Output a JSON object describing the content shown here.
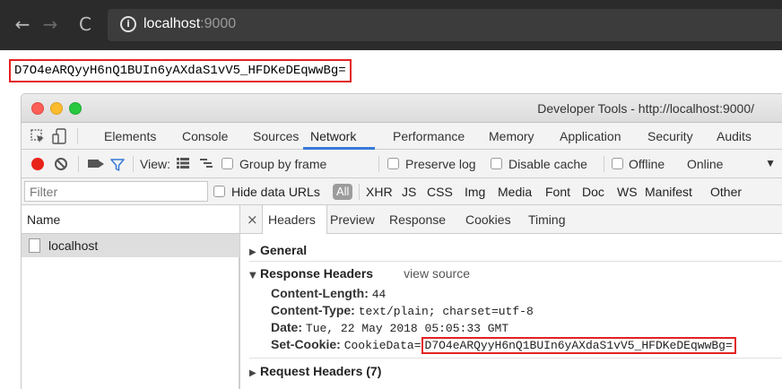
{
  "browser": {
    "back_glyph": "←",
    "forward_glyph": "→",
    "reload_glyph": "C",
    "info_glyph": "i",
    "url_host": "localhost",
    "url_port": ":9000"
  },
  "page": {
    "output_text": "D7O4eARQyyH6nQ1BUIn6yAXdaS1vV5_HFDKeDEqwwBg="
  },
  "devtools": {
    "window_title": "Developer Tools - http://localhost:9000/",
    "tabs": [
      {
        "label": "Elements"
      },
      {
        "label": "Console"
      },
      {
        "label": "Sources"
      },
      {
        "label": "Network"
      },
      {
        "label": "Performance"
      },
      {
        "label": "Memory"
      },
      {
        "label": "Application"
      },
      {
        "label": "Security"
      },
      {
        "label": "Audits"
      }
    ],
    "active_tab": "Network",
    "toolbar": {
      "view_label": "View:",
      "group_by_frame": "Group by frame",
      "preserve_log": "Preserve log",
      "disable_cache": "Disable cache",
      "offline": "Offline",
      "online": "Online",
      "dropdown_glyph": "▼"
    },
    "filterbar": {
      "filter_placeholder": "Filter",
      "hide_data_urls": "Hide data URLs",
      "types": [
        "All",
        "XHR",
        "JS",
        "CSS",
        "Img",
        "Media",
        "Font",
        "Doc",
        "WS",
        "Manifest",
        "Other"
      ]
    },
    "name_panel": {
      "header": "Name",
      "rows": [
        {
          "name": "localhost"
        }
      ]
    },
    "detail": {
      "close_glyph": "×",
      "tabs": [
        {
          "label": "Headers"
        },
        {
          "label": "Preview"
        },
        {
          "label": "Response"
        },
        {
          "label": "Cookies"
        },
        {
          "label": "Timing"
        }
      ],
      "active_tab": "Headers",
      "general_label": "General",
      "response_headers_label": "Response Headers",
      "view_source": "view source",
      "headers": [
        {
          "key": "Content-Length:",
          "value": "44"
        },
        {
          "key": "Content-Type:",
          "value": "text/plain; charset=utf-8"
        },
        {
          "key": "Date:",
          "value": "Tue, 22 May 2018 05:05:33 GMT"
        }
      ],
      "set_cookie_key": "Set-Cookie:",
      "set_cookie_prefix": "CookieData=",
      "set_cookie_value": "D7O4eARQyyH6nQ1BUIn6yAXdaS1vV5_HFDKeDEqwwBg=",
      "request_headers_label": "Request Headers (7)",
      "collapsed_glyph": "▶",
      "expanded_glyph": "▼"
    },
    "colors": {
      "highlight_box": "#e32222",
      "record": "#e8241a",
      "active_underline": "#3879d9"
    }
  }
}
